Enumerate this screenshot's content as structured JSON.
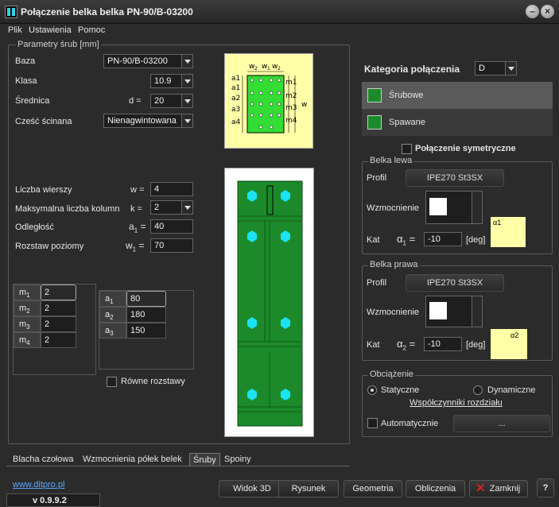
{
  "window": {
    "title": "Połączenie belka belka  PN-90/B-03200"
  },
  "menu": [
    "Plik",
    "Ustawienia",
    "Pomoc"
  ],
  "params": {
    "group_label": "Parametry śrub [mm]",
    "baza_label": "Baza",
    "baza_value": "PN-90/B-03200",
    "klasa_label": "Klasa",
    "klasa_value": "10.9",
    "srednica_label": "Średnica",
    "srednica_sym": "d =",
    "srednica_value": "20",
    "czesc_label": "Cześć ścinana",
    "czesc_value": "Nienagwintowana",
    "wiersze_label": "Liczba wierszy",
    "wiersze_sym": "w =",
    "wiersze_value": "4",
    "kolumny_label": "Maksymalna liczba kolumn",
    "kolumny_sym": "k =",
    "kolumny_value": "2",
    "odleglosc_label": "Odległość",
    "odleglosc_sym": "a",
    "odleglosc_sub": "1",
    "odleglosc_eq": "=",
    "odleglosc_value": "40",
    "rozstaw_label": "Rozstaw poziomy",
    "rozstaw_sym": "w",
    "rozstaw_sub": "1",
    "rozstaw_eq": "=",
    "rozstaw_value": "70"
  },
  "diagram_labels": {
    "top": [
      "w",
      "2",
      "w",
      "1",
      "w",
      "2"
    ],
    "left": [
      "a1",
      "a1",
      "a2",
      "a3",
      "a4"
    ],
    "right": [
      "m1",
      "m2",
      "m3",
      "m4"
    ],
    "w": "w"
  },
  "m_table": [
    {
      "sym": "m",
      "sub": "1",
      "value": "2"
    },
    {
      "sym": "m",
      "sub": "2",
      "value": "2"
    },
    {
      "sym": "m",
      "sub": "3",
      "value": "2"
    },
    {
      "sym": "m",
      "sub": "4",
      "value": "2"
    }
  ],
  "a_table": [
    {
      "sym": "a",
      "sub": "1",
      "value": "80"
    },
    {
      "sym": "a",
      "sub": "2",
      "value": "180"
    },
    {
      "sym": "a",
      "sub": "3",
      "value": "150"
    }
  ],
  "rowne_label": "Równe rozstawy",
  "tabs": [
    "Blacha czołowa",
    "Wzmocnienia półek belek",
    "Śruby",
    "Spoiny"
  ],
  "kategoria": {
    "label": "Kategoria połączenia",
    "value": "D"
  },
  "conn_types": [
    "Śrubowe",
    "Spawane"
  ],
  "symetryczne_label": "Połączenie symetryczne",
  "belka_lewa": {
    "group_label": "Belka lewa",
    "profil_label": "Profil",
    "profil_value": "IPE270 St3SX",
    "wzm_label": "Wzmocnienie",
    "kat_label": "Kat",
    "alpha_sym": "α",
    "alpha_sub": "1",
    "alpha_eq": "=",
    "kat_value": "-10",
    "kat_unit": "[deg]",
    "pic_label_alpha": "α1"
  },
  "belka_prawa": {
    "group_label": "Belka prawa",
    "profil_label": "Profil",
    "profil_value": "IPE270 St3SX",
    "wzm_label": "Wzmocnienie",
    "kat_label": "Kat",
    "alpha_sym": "α",
    "alpha_sub": "2",
    "alpha_eq": "=",
    "kat_value": "-10",
    "kat_unit": "[deg]",
    "pic_label_alpha": "α2"
  },
  "obciazenie": {
    "group_label": "Obciążenie",
    "statyczne": "Statyczne",
    "dynamiczne": "Dynamiczne",
    "wspolczynniki": "Współczynniki rozdziału",
    "automatycznie": "Automatycznie",
    "dots": "..."
  },
  "footer": {
    "link": "www.ditpro.pl",
    "version": "v 0.9.9.2",
    "buttons": [
      "Widok 3D",
      "Rysunek",
      "Geometria",
      "Obliczenia",
      "Zamknij"
    ],
    "help": "?"
  },
  "colors": {
    "accent_green": "#1c8a2a",
    "bolt": "#19e3f5",
    "sketch_bg": "#ffffa8",
    "close_red": "#d82020"
  }
}
